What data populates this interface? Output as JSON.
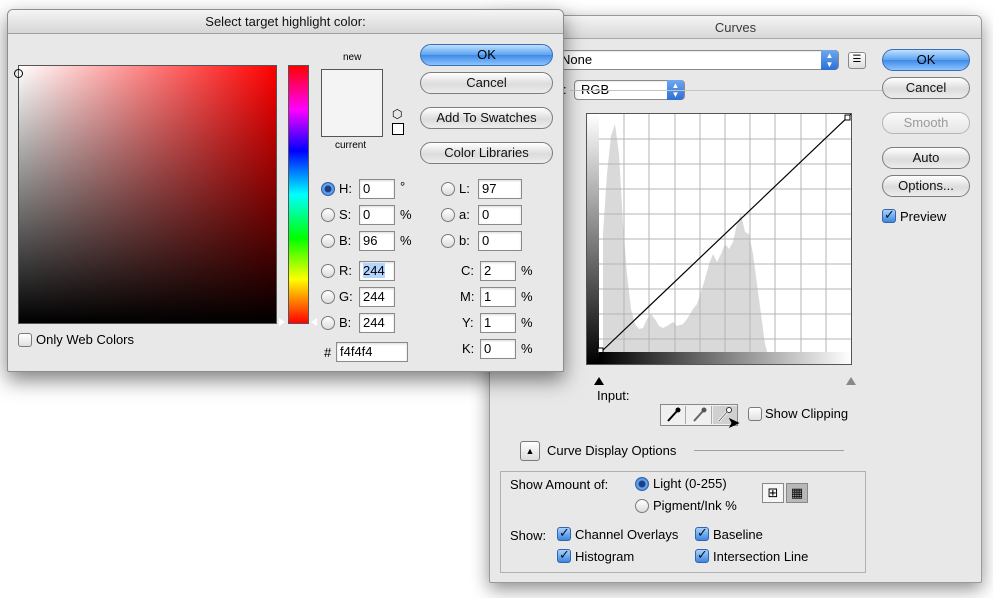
{
  "curves": {
    "title": "Curves",
    "preset_value": "None",
    "channel_label": ":",
    "channel_value": "RGB",
    "buttons": {
      "ok": "OK",
      "cancel": "Cancel",
      "smooth": "Smooth",
      "auto": "Auto",
      "options": "Options..."
    },
    "preview_label": "Preview",
    "preview_checked": true,
    "input_label": "Input:",
    "show_clipping_label": "Show Clipping",
    "curve_display_options_label": "Curve Display Options",
    "show_amount_label": "Show Amount of:",
    "light_label": "Light  (0-255)",
    "pigment_label": "Pigment/Ink %",
    "show_label": "Show:",
    "show_options": {
      "channel_overlays": "Channel Overlays",
      "baseline": "Baseline",
      "histogram": "Histogram",
      "intersection_line": "Intersection Line"
    }
  },
  "picker": {
    "title": "Select target highlight color:",
    "new_label": "new",
    "current_label": "current",
    "buttons": {
      "ok": "OK",
      "cancel": "Cancel",
      "add_to_swatches": "Add To Swatches",
      "color_libraries": "Color Libraries"
    },
    "only_web_colors_label": "Only Web Colors",
    "fields": {
      "h": {
        "label": "H:",
        "value": "0",
        "unit": "°"
      },
      "s": {
        "label": "S:",
        "value": "0",
        "unit": "%"
      },
      "b": {
        "label": "B:",
        "value": "96",
        "unit": "%"
      },
      "r": {
        "label": "R:",
        "value": "244"
      },
      "g": {
        "label": "G:",
        "value": "244"
      },
      "b2": {
        "label": "B:",
        "value": "244"
      },
      "l": {
        "label": "L:",
        "value": "97"
      },
      "a": {
        "label": "a:",
        "value": "0"
      },
      "lb": {
        "label": "b:",
        "value": "0"
      },
      "c": {
        "label": "C:",
        "value": "2",
        "unit": "%"
      },
      "m": {
        "label": "M:",
        "value": "1",
        "unit": "%"
      },
      "y": {
        "label": "Y:",
        "value": "1",
        "unit": "%"
      },
      "k": {
        "label": "K:",
        "value": "0",
        "unit": "%"
      }
    },
    "hex_label": "#",
    "hex_value": "f4f4f4",
    "swatch_color": "#f4f4f4"
  },
  "colors": {
    "accent": "#3f8ae6"
  }
}
